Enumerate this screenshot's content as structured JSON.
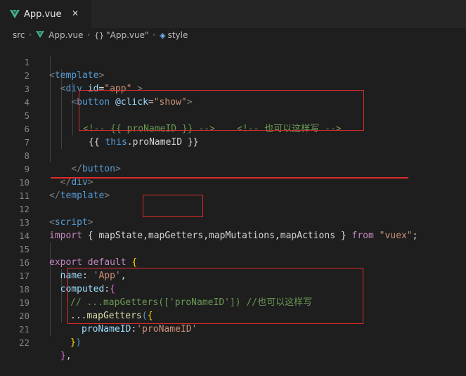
{
  "tab": {
    "title": "App.vue",
    "close_glyph": "✕",
    "icon": "vue-logo-icon"
  },
  "breadcrumb": {
    "folder": "src",
    "file": "App.vue",
    "object": "\"App.vue\"",
    "section": "style",
    "separator": "›"
  },
  "line_numbers": [
    "1",
    "2",
    "3",
    "4",
    "5",
    "6",
    "7",
    "8",
    "9",
    "10",
    "11",
    "12",
    "13",
    "14",
    "15",
    "16",
    "17",
    "18",
    "19",
    "20",
    "21",
    "22"
  ],
  "code": {
    "l1_tag": "template",
    "l2_tag": "div",
    "l2_attr": "id",
    "l2_val": "\"app\"",
    "l3_tag": "button",
    "l3_attr": "@click",
    "l3_val": "\"show\"",
    "l5_comment1": "<!-- {{ proNameID }} -->",
    "l5_comment2": "<!-- 也可以这样写 -->",
    "l6_open": "{{",
    "l6_this": "this",
    "l6_prop": ".proNameID",
    "l6_close": "}}",
    "l8_tag": "button",
    "l9_tag": "div",
    "l10_tag": "template",
    "l12_tag": "script",
    "l13_import": "import",
    "l13_lbrace": "{",
    "l13_names": [
      " mapState,",
      "mapGetters",
      ",mapMutations,mapActions "
    ],
    "l13_rbrace": "}",
    "l13_from": "from",
    "l13_src": "\"vuex\"",
    "l13_semi": ";",
    "l15_export": "export",
    "l15_default": "default",
    "l15_brace": "{",
    "l16_key": "name",
    "l16_colon": ": ",
    "l16_val": "'App'",
    "l16_comma": ",",
    "l17_key": "computed",
    "l17_colon": ":",
    "l17_brace": "{",
    "l18_comment": "// ...mapGetters(['proNameID']) //也可以这样写",
    "l19_spread": "...",
    "l19_fn": "mapGetters",
    "l19_paren": "(",
    "l19_brace": "{",
    "l20_key": "proNameID",
    "l20_colon": ":",
    "l20_val": "'proNameID'",
    "l21_brace": "}",
    "l21_paren": ")",
    "l22_brace": "}",
    "l22_comma": ","
  },
  "colors": {
    "background": "#1e1e1e",
    "highlight": "#e02b2b",
    "tag": "#569cd6",
    "string": "#ce9178",
    "comment": "#6a9955",
    "keyword": "#c586c0"
  }
}
